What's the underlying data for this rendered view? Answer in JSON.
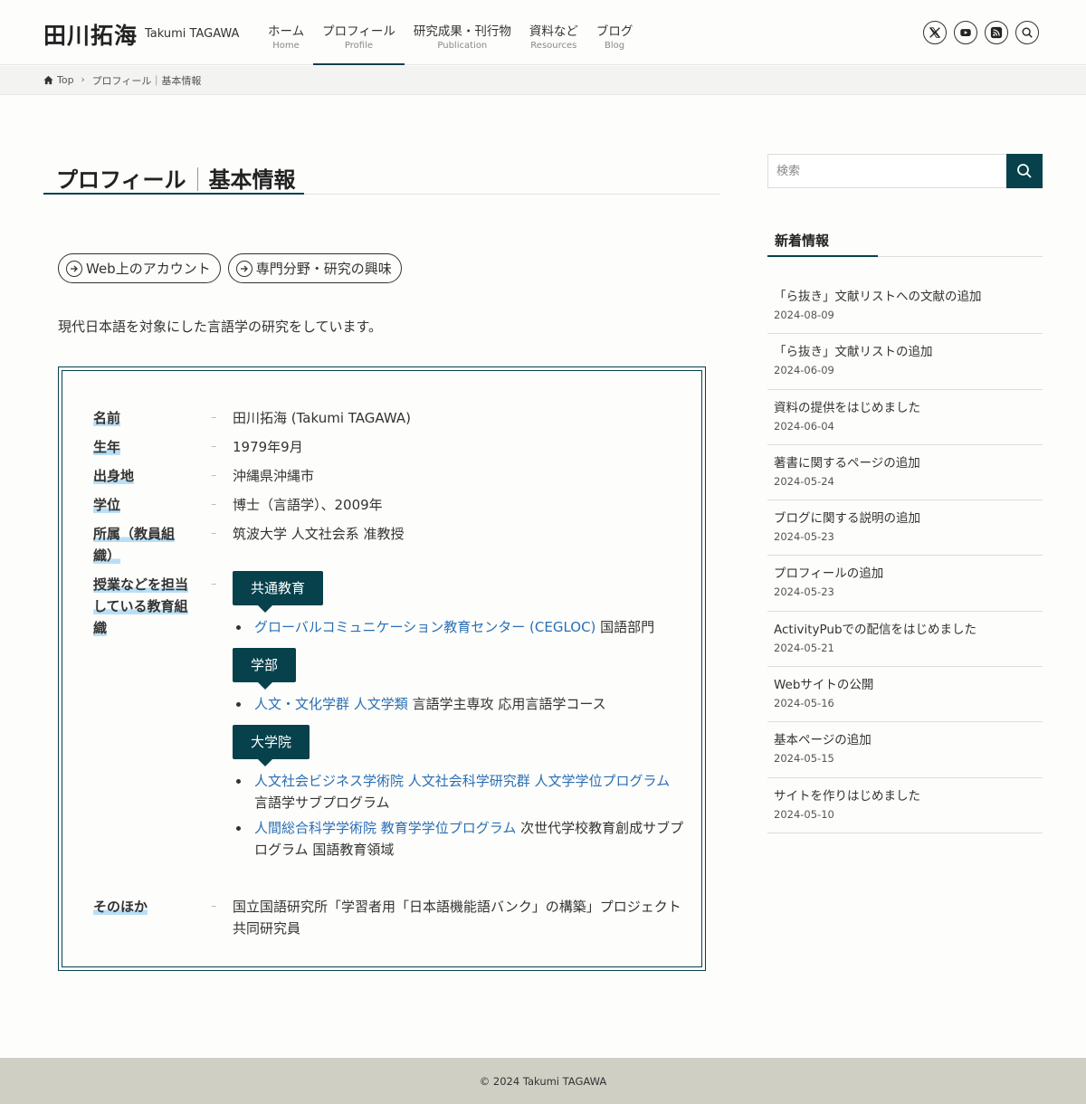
{
  "site": {
    "title": "田川拓海",
    "subtitle": "Takumi TAGAWA"
  },
  "nav": [
    {
      "jp": "ホーム",
      "en": "Home"
    },
    {
      "jp": "プロフィール",
      "en": "Profile"
    },
    {
      "jp": "研究成果・刊行物",
      "en": "Publication"
    },
    {
      "jp": "資料など",
      "en": "Resources"
    },
    {
      "jp": "ブログ",
      "en": "Blog"
    }
  ],
  "header_icons": [
    "x-icon",
    "youtube-icon",
    "rss-icon",
    "search-icon"
  ],
  "breadcrumb": {
    "home": "Top",
    "current": "プロフィール｜基本情報"
  },
  "page": {
    "title_a": "プロフィール",
    "title_b": "基本情報",
    "buttons": [
      "Web上のアカウント",
      "専門分野・研究の興味"
    ],
    "intro": "現代日本語を対象にした言語学の研究をしています。"
  },
  "info": {
    "name_label": "名前",
    "name_value": "田川拓海 (Takumi TAGAWA)",
    "birth_label": "生年",
    "birth_value": "1979年9月",
    "from_label": "出身地",
    "from_value": "沖縄県沖縄市",
    "degree_label": "学位",
    "degree_value": "博士（言語学）、2009年",
    "affil_label_1": "所属（教員組",
    "affil_label_2": "織）",
    "affil_value": "筑波大学 人文社会系 准教授",
    "teach_label_1": "授業などを担当",
    "teach_label_2": "している教育組",
    "teach_label_3": "織",
    "tag_common": "共通教育",
    "common_link": "グローバルコミュニケーション教育センター (CEGLOC)",
    "common_rest": " 国語部門",
    "tag_undergrad": "学部",
    "undergrad_link": "人文・文化学群 人文学類",
    "undergrad_rest": " 言語学主専攻 応用言語学コース",
    "tag_grad": "大学院",
    "grad1_link": "人文社会ビジネス学術院 人文社会科学研究群 人文学学位プログラム",
    "grad1_rest": " 言語学サブプログラム",
    "grad2_link": "人間総合科学学術院 教育学学位プログラム",
    "grad2_rest": " 次世代学校教育創成サブプログラム 国語教育領域",
    "other_label": "そのほか",
    "other_value": "国立国語研究所「学習者用「日本語機能語バンク」の構築」プロジェクト共同研究員"
  },
  "sidebar": {
    "search_placeholder": "検索",
    "news_heading": "新着情報",
    "news": [
      {
        "title": "「ら抜き」文献リストへの文献の追加",
        "date": "2024-08-09"
      },
      {
        "title": "「ら抜き」文献リストの追加",
        "date": "2024-06-09"
      },
      {
        "title": "資料の提供をはじめました",
        "date": "2024-06-04"
      },
      {
        "title": "著書に関するページの追加",
        "date": "2024-05-24"
      },
      {
        "title": "ブログに関する説明の追加",
        "date": "2024-05-23"
      },
      {
        "title": "プロフィールの追加",
        "date": "2024-05-23"
      },
      {
        "title": "ActivityPubでの配信をはじめました",
        "date": "2024-05-21"
      },
      {
        "title": "Webサイトの公開",
        "date": "2024-05-16"
      },
      {
        "title": "基本ページの追加",
        "date": "2024-05-15"
      },
      {
        "title": "サイトを作りはじめました",
        "date": "2024-05-10"
      }
    ]
  },
  "footer": {
    "copyright": "© 2024 Takumi TAGAWA"
  },
  "colors": {
    "accent": "#06414c",
    "link": "#2a6fb5",
    "marker": "#b9dff6",
    "footer_bg": "#cfcfc4"
  }
}
